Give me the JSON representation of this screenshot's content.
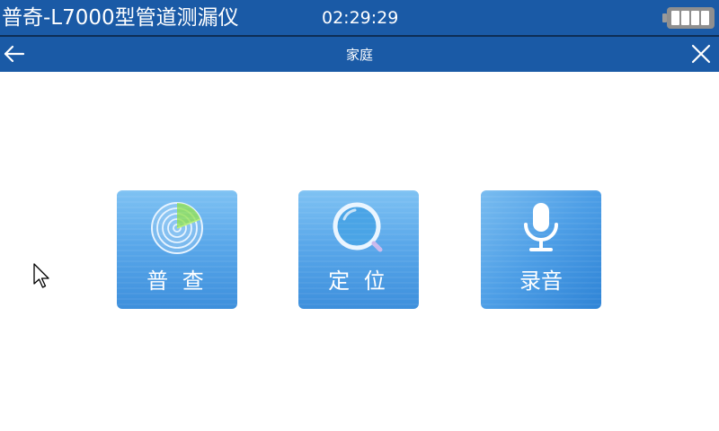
{
  "status_bar": {
    "device_title": "普奇-L7000型管道测漏仪",
    "clock": "02:29:29",
    "battery_icon": "battery-full-icon"
  },
  "nav_bar": {
    "title": "家庭",
    "back_icon": "arrow-left-icon",
    "close_icon": "close-icon"
  },
  "tiles": [
    {
      "label": "普 查",
      "icon": "radar-icon"
    },
    {
      "label": "定 位",
      "icon": "magnifier-icon"
    },
    {
      "label": "录音",
      "icon": "microphone-icon"
    }
  ],
  "colors": {
    "header_blue": "#1a5aa6",
    "tile_blue_light": "#7fc2f3",
    "tile_blue_dark": "#3d8fdc",
    "radar_green": "#8ee04a"
  }
}
